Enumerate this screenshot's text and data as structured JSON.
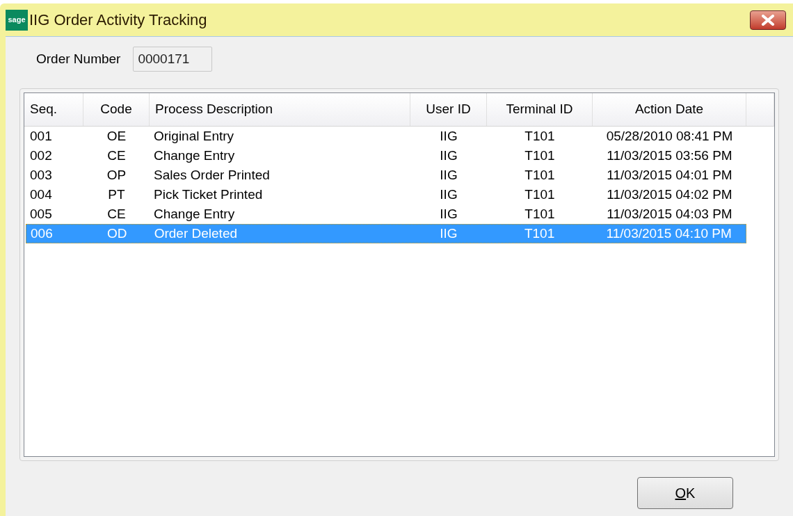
{
  "window": {
    "logo_text": "sage",
    "title": "IIG Order Activity Tracking"
  },
  "order_number": {
    "label": "Order Number",
    "value": "0000171"
  },
  "table": {
    "columns": [
      "Seq.",
      "Code",
      "Process Description",
      "User ID",
      "Terminal ID",
      "Action Date"
    ],
    "rows": [
      {
        "cells": [
          "001",
          "OE",
          "Original Entry",
          "IIG",
          "T101",
          "05/28/2010 08:41 PM"
        ],
        "selected": false
      },
      {
        "cells": [
          "002",
          "CE",
          "Change Entry",
          "IIG",
          "T101",
          "11/03/2015 03:56 PM"
        ],
        "selected": false
      },
      {
        "cells": [
          "003",
          "OP",
          "Sales Order Printed",
          "IIG",
          "T101",
          "11/03/2015 04:01 PM"
        ],
        "selected": false
      },
      {
        "cells": [
          "004",
          "PT",
          "Pick Ticket Printed",
          "IIG",
          "T101",
          "11/03/2015 04:02 PM"
        ],
        "selected": false
      },
      {
        "cells": [
          "005",
          "CE",
          "Change Entry",
          "IIG",
          "T101",
          "11/03/2015 04:03 PM"
        ],
        "selected": false
      },
      {
        "cells": [
          "006",
          "OD",
          "Order Deleted",
          "IIG",
          "T101",
          "11/03/2015 04:10 PM"
        ],
        "selected": true
      }
    ]
  },
  "ok_button": {
    "label": "OK"
  }
}
